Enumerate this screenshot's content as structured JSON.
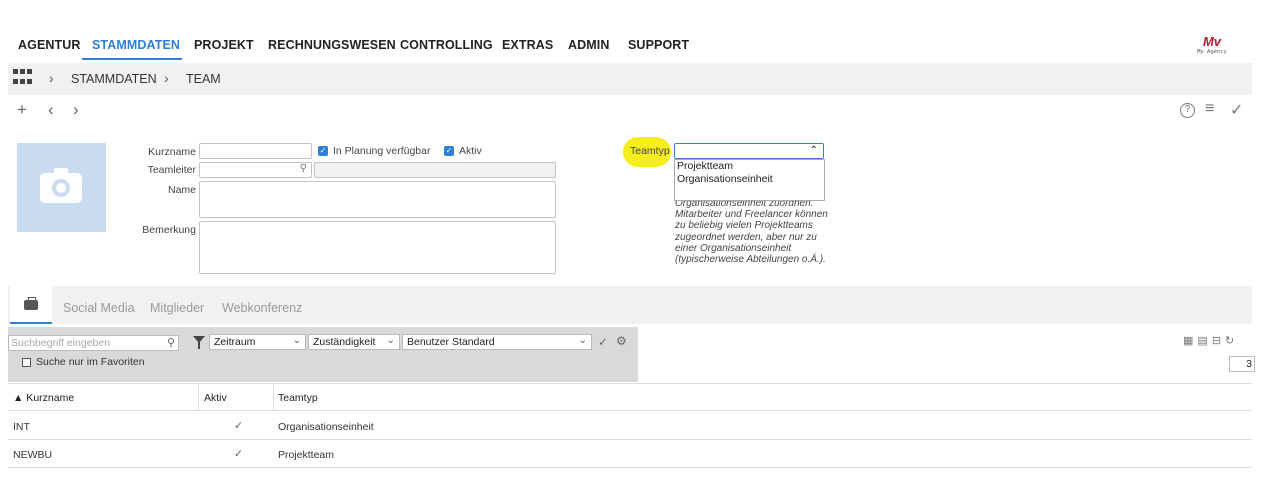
{
  "nav": {
    "items": [
      "AGENTUR",
      "STAMMDATEN",
      "PROJEKT",
      "RECHNUNGSWESEN",
      "CONTROLLING",
      "EXTRAS",
      "ADMIN",
      "SUPPORT"
    ],
    "active": "STAMMDATEN",
    "accent": "#2e7fd6"
  },
  "logo": {
    "mark": "Mv",
    "sub": "My Agency"
  },
  "breadcrumb": {
    "items": [
      "STAMMDATEN",
      "TEAM"
    ],
    "separator": "›"
  },
  "toolbar": {
    "add": "+",
    "prev": "‹",
    "next": "›",
    "help": "?",
    "menu": "≡",
    "save": "✓"
  },
  "form": {
    "kurzname_label": "Kurzname",
    "teamleiter_label": "Teamleiter",
    "name_label": "Name",
    "bemerkung_label": "Bemerkung",
    "in_planung_label": "In Planung verfügbar",
    "aktiv_label": "Aktiv",
    "teamtyp_label": "Teamtyp",
    "teamtyp_value": "",
    "teamtyp_options": [
      "Projektteam",
      "Organisationseinheit"
    ],
    "hint_lines": [
      "Organisationseinheit zuordnen.",
      "Mitarbeiter und Freelancer können",
      "zu beliebig vielen Projektteams",
      "zugeordnet werden, aber nur zu",
      "einer Organisationseinheit",
      "(typischerweise Abteilungen o.Ä.)."
    ]
  },
  "tabs": [
    "Social Media",
    "Mitglieder",
    "Webkonferenz"
  ],
  "filter": {
    "search_placeholder": "Suchbegriff eingeben",
    "favorites_label": "Suche nur im Favoriten",
    "zeitraum": "Zeitraum",
    "zustaendigkeit": "Zuständigkeit",
    "benutzer": "Benutzer Standard",
    "count": "3"
  },
  "table": {
    "headers": [
      "▲ Kurzname",
      "Aktiv",
      "Teamtyp"
    ],
    "rows": [
      {
        "kurzname": "INT",
        "aktiv": "✓",
        "teamtyp": "Organisationseinheit"
      },
      {
        "kurzname": "NEWBU",
        "aktiv": "✓",
        "teamtyp": "Projektteam"
      }
    ]
  }
}
